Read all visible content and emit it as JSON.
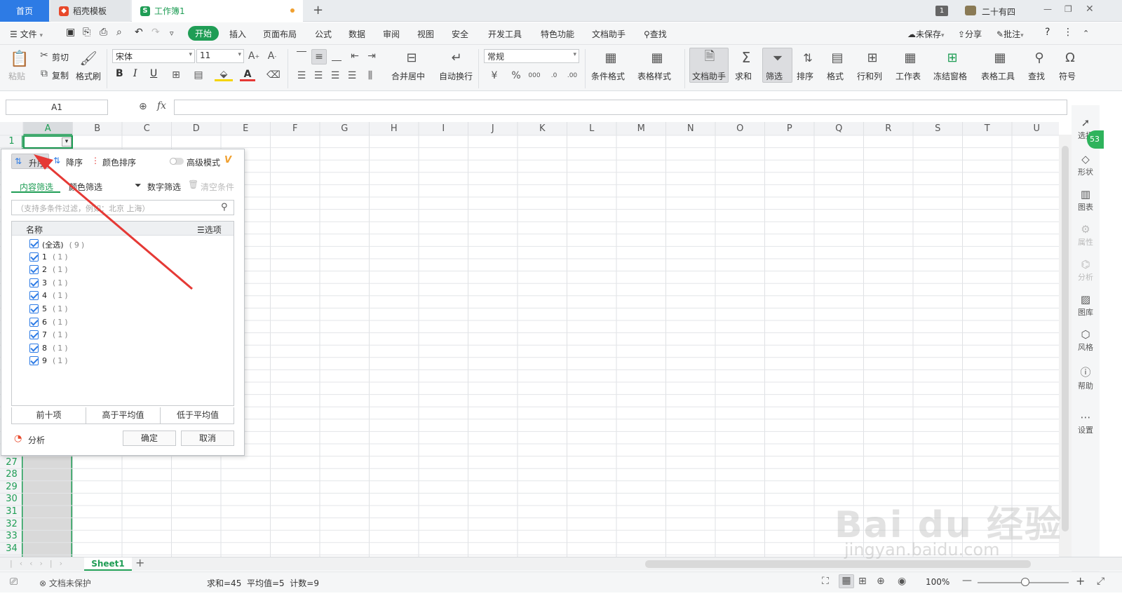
{
  "titlebar": {
    "tabs": [
      {
        "label": "首页"
      },
      {
        "label": "稻壳模板"
      },
      {
        "label": "工作簿1"
      }
    ],
    "new_tab": "+",
    "page_badge": "1",
    "user": "二十有四"
  },
  "menubar": {
    "file": "文件",
    "items": [
      "开始",
      "插入",
      "页面布局",
      "公式",
      "数据",
      "审阅",
      "视图",
      "安全",
      "开发工具",
      "特色功能",
      "文档助手"
    ],
    "search": "查找",
    "unsaved": "未保存",
    "share": "分享",
    "comment": "批注"
  },
  "ribbon": {
    "paste": "粘贴",
    "cut": "剪切",
    "copy": "复制",
    "format_painter": "格式刷",
    "font_name": "宋体",
    "font_size": "11",
    "bold": "B",
    "italic": "I",
    "underline": "U",
    "merge_center": "合并居中",
    "wrap_text": "自动换行",
    "number_format": "常规",
    "conditional_format": "条件格式",
    "table_style": "表格样式",
    "doc_assistant": "文档助手",
    "sum": "求和",
    "filter": "筛选",
    "sort": "排序",
    "format": "格式",
    "row_col": "行和列",
    "worksheet": "工作表",
    "freeze": "冻结窗格",
    "table_tools": "表格工具",
    "find": "查找",
    "symbol": "符号"
  },
  "formula_bar": {
    "name_box": "A1",
    "fx": "fx"
  },
  "grid": {
    "columns": [
      "A",
      "B",
      "C",
      "D",
      "E",
      "F",
      "G",
      "H",
      "I",
      "J",
      "K",
      "L",
      "M",
      "N",
      "O",
      "P",
      "Q",
      "R",
      "S",
      "T",
      "U"
    ],
    "visible_rows_top": [
      "1"
    ],
    "visible_rows_bottom": [
      "27",
      "28",
      "29",
      "30",
      "31",
      "32",
      "33",
      "34"
    ]
  },
  "right_panel": {
    "items": [
      "选择",
      "形状",
      "图表",
      "属性",
      "分析",
      "图库",
      "风格",
      "帮助",
      "设置"
    ],
    "badge": "53"
  },
  "filter_popup": {
    "sort_asc": "升序",
    "sort_desc": "降序",
    "sort_color": "颜色排序",
    "advanced_mode": "高级模式",
    "tab_content": "内容筛选",
    "tab_color": "颜色筛选",
    "number_filter": "数字筛选",
    "clear_conditions": "清空条件",
    "search_placeholder": "（支持多条件过滤，例如：北京  上海）",
    "list_header": "名称",
    "options": "选项",
    "items": [
      {
        "label": "(全选)",
        "count": "(9)"
      },
      {
        "label": "1",
        "count": "(1)"
      },
      {
        "label": "2",
        "count": "(1)"
      },
      {
        "label": "3",
        "count": "(1)"
      },
      {
        "label": "4",
        "count": "(1)"
      },
      {
        "label": "5",
        "count": "(1)"
      },
      {
        "label": "6",
        "count": "(1)"
      },
      {
        "label": "7",
        "count": "(1)"
      },
      {
        "label": "8",
        "count": "(1)"
      },
      {
        "label": "9",
        "count": "(1)"
      }
    ],
    "top10": "前十项",
    "above_avg": "高于平均值",
    "below_avg": "低于平均值",
    "analysis": "分析",
    "ok": "确定",
    "cancel": "取消"
  },
  "sheet_tabs": {
    "active": "Sheet1",
    "add": "+"
  },
  "statusbar": {
    "protect": "文档未保护",
    "summary": "求和=45  平均值=5  计数=9",
    "zoom": "100%"
  },
  "watermark": {
    "brand": "Bai du 经验",
    "url": "jingyan.baidu.com"
  },
  "colors": {
    "accent_green": "#1f9d55",
    "accent_blue": "#2d7be5",
    "arrow_red": "#e53935"
  }
}
